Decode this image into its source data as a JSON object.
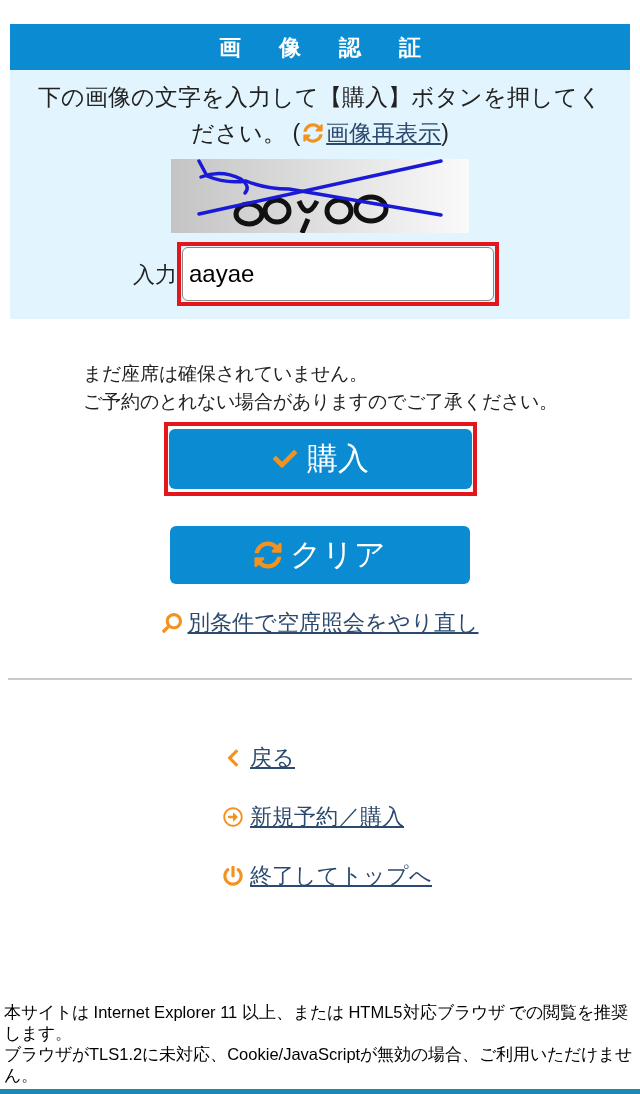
{
  "captcha_panel": {
    "title": "画像認証",
    "instruction": "下の画像の文字を入力して【購入】ボタンを押してください。",
    "refresh_open": "(",
    "refresh_link": "画像再表示",
    "refresh_close": ")",
    "input_label": "入力",
    "input": {
      "value": "aayae",
      "highlighted": true
    }
  },
  "notice_lines": [
    "まだ座席は確保されていません。",
    "ご予約のとれない場合がありますのでご了承ください。"
  ],
  "buttons": [
    {
      "kind": "purchase",
      "label": "購入",
      "highlighted": true
    },
    {
      "kind": "clear",
      "label": "クリア",
      "highlighted": false
    }
  ],
  "search_again_link": "別条件で空席照会をやり直し",
  "nav_links": [
    {
      "kind": "back",
      "label": "戻る"
    },
    {
      "kind": "new",
      "label": "新規予約／購入"
    },
    {
      "kind": "exit",
      "label": "終了してトップへ"
    }
  ],
  "footer_notes": [
    "本サイトは Internet Explorer 11 以上、または HTML5対応ブラウザ での閲覧を推奨します。",
    "ブラウザがTLS1.2に未対応、Cookie/JavaScriptが無効の場合、ご利用いただけません。"
  ]
}
